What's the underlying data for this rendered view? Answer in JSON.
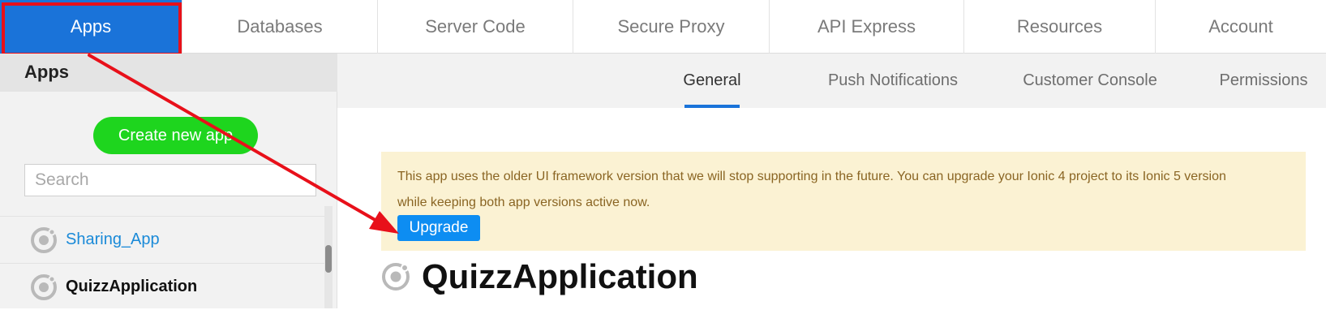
{
  "topnav": {
    "tabs": [
      {
        "label": "Apps",
        "active": true
      },
      {
        "label": "Databases"
      },
      {
        "label": "Server Code"
      },
      {
        "label": "Secure Proxy"
      },
      {
        "label": "API Express"
      },
      {
        "label": "Resources"
      },
      {
        "label": "Account"
      }
    ]
  },
  "sidebar": {
    "title": "Apps",
    "create_button": "Create new app",
    "search_placeholder": "Search",
    "apps": [
      {
        "name": "Sharing_App",
        "icon": "ionic-ring-icon"
      },
      {
        "name": "QuizzApplication",
        "icon": "ionic-ring-icon",
        "selected": true
      }
    ]
  },
  "subnav": {
    "tabs": [
      {
        "label": "General",
        "active": true
      },
      {
        "label": "Push Notifications"
      },
      {
        "label": "Customer Console"
      },
      {
        "label": "Permissions"
      }
    ]
  },
  "notice": {
    "line1": "This app uses the older UI framework version that we will stop supporting in the future. You can upgrade your Ionic 4 project to its Ionic 5 version",
    "line2": "while keeping both app versions active now.",
    "upgrade_button": "Upgrade"
  },
  "app": {
    "title": "QuizzApplication",
    "icon": "ionic-ring-icon"
  },
  "colors": {
    "accent": "#1a73d9",
    "create_green": "#1ed51e",
    "notice_bg": "#fbf2d3",
    "annotation_red": "#e8101a"
  }
}
